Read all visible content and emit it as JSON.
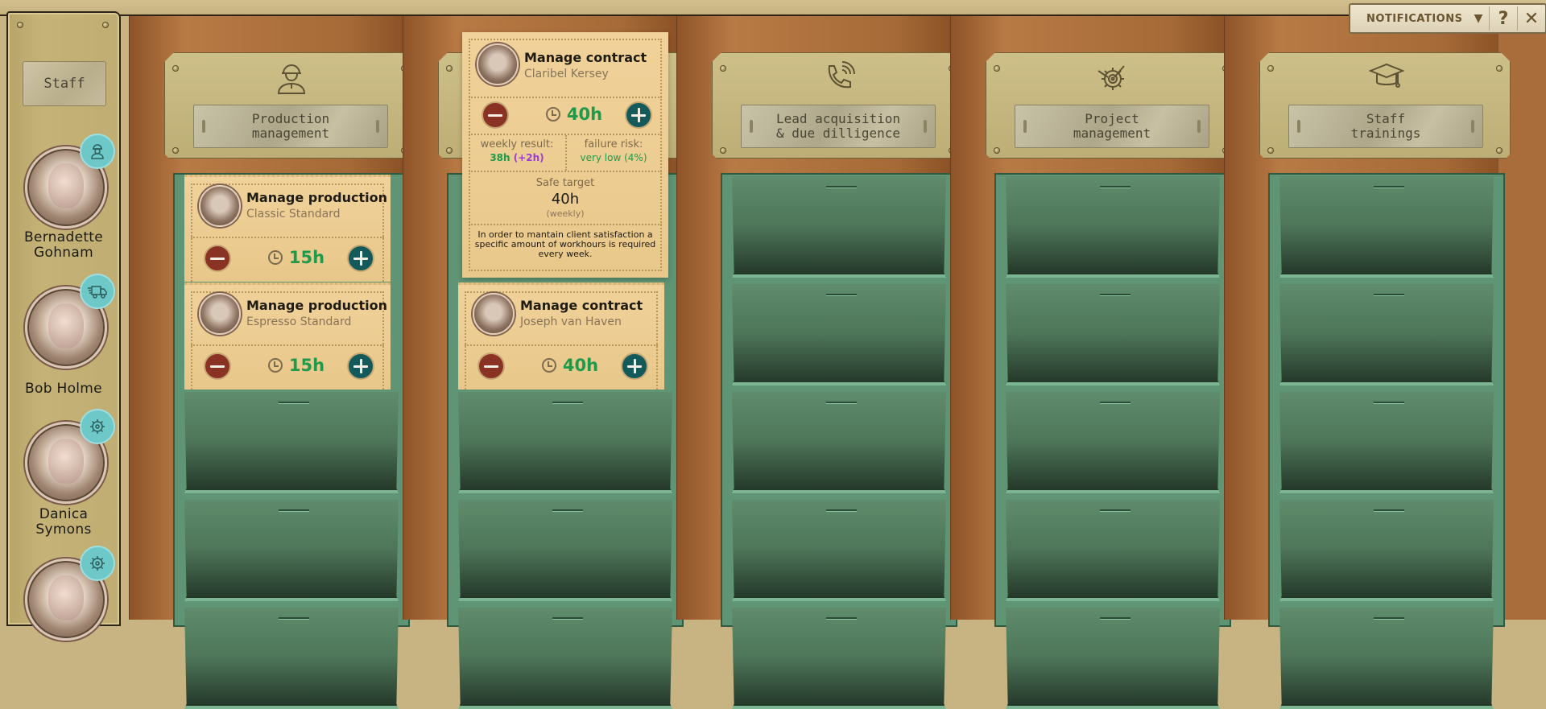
{
  "top_bar": {
    "notifications_label": "NOTIFICATIONS",
    "dropdown_icon": "triangle-down-icon",
    "help_label": "?",
    "close_label": "✕"
  },
  "sidebar": {
    "title": "Staff",
    "staff": [
      {
        "name": "Bernadette Gohnam",
        "role_icon": "construction-worker-icon"
      },
      {
        "name": "Bob Holme",
        "role_icon": "delivery-truck-icon"
      },
      {
        "name": "Danica Symons",
        "role_icon": "gear-target-icon"
      },
      {
        "name": "",
        "role_icon": "gear-target-icon"
      }
    ]
  },
  "columns": [
    {
      "id": "production",
      "label": "Production\nmanagement",
      "icon": "construction-worker-icon"
    },
    {
      "id": "contracts",
      "label": "",
      "icon": ""
    },
    {
      "id": "leads",
      "label": "Lead acquisition\n& due dilligence",
      "icon": "phone-ringing-icon"
    },
    {
      "id": "projects",
      "label": "Project\nmanagement",
      "icon": "gear-target-icon"
    },
    {
      "id": "trainings",
      "label": "Staff\ntrainings",
      "icon": "graduation-cap-icon"
    }
  ],
  "cards": {
    "production": [
      {
        "title": "Manage production",
        "subtitle": "Classic Standard",
        "hours": "15h"
      },
      {
        "title": "Manage production",
        "subtitle": "Espresso Standard",
        "hours": "15h"
      }
    ],
    "contracts": [
      {
        "title": "Manage contract",
        "subtitle": "Joseph van Haven",
        "hours": "40h"
      }
    ]
  },
  "expanded_card": {
    "title": "Manage contract",
    "subtitle": "Claribel Kersey",
    "hours": "40h",
    "weekly_result_label": "weekly result:",
    "weekly_result_value": "38h",
    "weekly_result_delta": "(+2h)",
    "failure_risk_label": "failure risk:",
    "failure_risk_value": "very low (4%)",
    "safe_target_label": "Safe target",
    "safe_target_value": "40h",
    "safe_target_unit": "(weekly)",
    "description": "In order to mantain client satisfaction a specific amount of workhours is required every week."
  },
  "colors": {
    "hours_green": "#1f9a4b",
    "delta_purple": "#9a3fd0",
    "minus_red": "#8a3324",
    "plus_teal": "#155a5a",
    "badge_teal": "#6ec8c8"
  }
}
